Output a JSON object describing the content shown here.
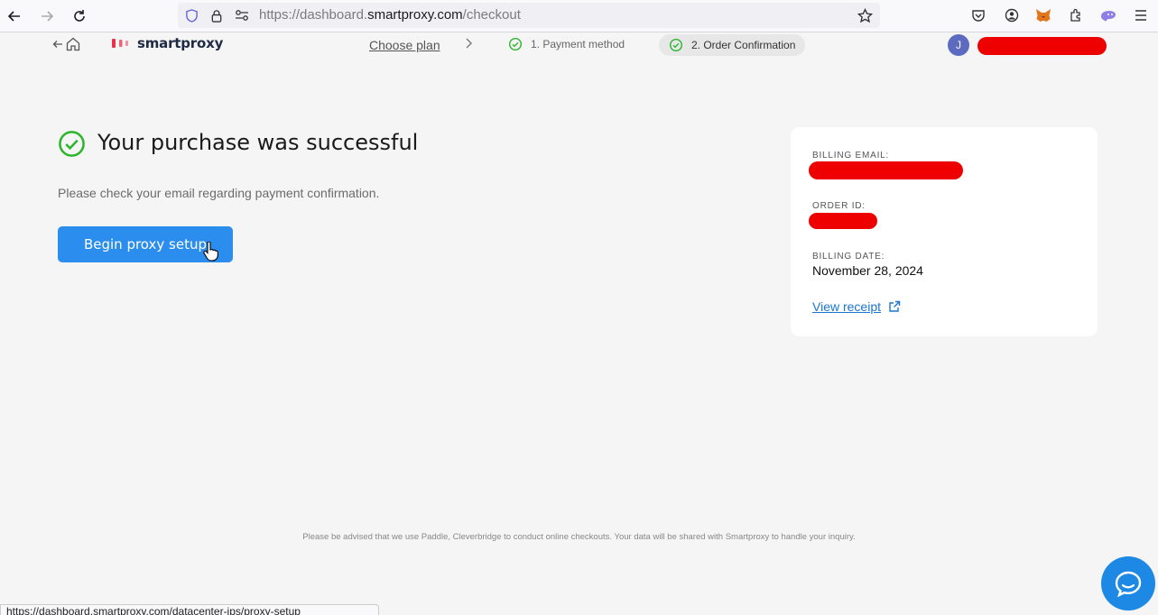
{
  "browser": {
    "url_prefix": "https://dashboard.",
    "url_domain": "smartproxy.com",
    "url_path": "/checkout",
    "status_url": "https://dashboard.smartproxy.com/datacenter-ips/proxy-setup"
  },
  "header": {
    "logo_text": "smartproxy",
    "choose_plan": "Choose plan",
    "step1": "1. Payment method",
    "step2": "2. Order Confirmation",
    "avatar_initial": "J"
  },
  "main": {
    "title": "Your purchase was successful",
    "subtitle": "Please check your email regarding payment confirmation.",
    "begin_button": "Begin proxy setup"
  },
  "card": {
    "billing_email_label": "BILLING EMAIL:",
    "order_id_label": "ORDER ID:",
    "billing_date_label": "BILLING DATE:",
    "billing_date": "November 28, 2024",
    "view_receipt": "View receipt"
  },
  "footer": {
    "note": "Please be advised that we use Paddle, Cleverbridge to conduct online checkouts. Your data will be shared with Smartproxy to handle your inquiry."
  },
  "colors": {
    "accent": "#2b8eef",
    "success": "#2cb52c",
    "redaction": "#e00000"
  },
  "icons": [
    "back-arrow-icon",
    "forward-arrow-icon",
    "reload-icon",
    "shield-icon",
    "lock-icon",
    "permissions-icon",
    "bookmark-star-icon",
    "pocket-icon",
    "account-icon",
    "metamask-icon",
    "extensions-icon",
    "extension-icon",
    "menu-icon",
    "home-icon",
    "check-circle-icon",
    "chevron-right-icon",
    "external-link-icon",
    "chat-icon"
  ]
}
